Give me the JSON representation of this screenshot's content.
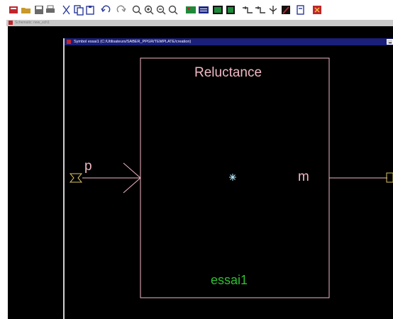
{
  "toolbar": {
    "buttons": [
      {
        "name": "new-schematic-icon",
        "color": "#c0262c"
      },
      {
        "name": "open-folder-icon",
        "color": "#c89a2a"
      },
      {
        "name": "save-icon",
        "color": "#6a6a6a"
      },
      {
        "name": "print-icon",
        "color": "#6a6a6a"
      },
      {
        "name": "cut-icon",
        "color": "#2a3a9a"
      },
      {
        "name": "copy-icon",
        "color": "#2a3a9a"
      },
      {
        "name": "paste-icon",
        "color": "#2a3a9a"
      },
      {
        "name": "undo-icon",
        "color": "#2a3a9a"
      },
      {
        "name": "redo-icon",
        "color": "#888888"
      },
      {
        "name": "zoom-fit-icon",
        "color": "#444444"
      },
      {
        "name": "zoom-in-icon",
        "color": "#444444"
      },
      {
        "name": "zoom-out-icon",
        "color": "#444444"
      },
      {
        "name": "zoom-area-icon",
        "color": "#444444"
      },
      {
        "name": "hierarchy-icon",
        "color": "#1f8a3a"
      },
      {
        "name": "net-list-icon",
        "color": "#1f2a8a"
      },
      {
        "name": "grid-icon",
        "color": "#1f8a3a"
      },
      {
        "name": "component-icon",
        "color": "#1f8a3a"
      },
      {
        "name": "wire-icon",
        "color": "#333333"
      },
      {
        "name": "bus-icon",
        "color": "#333333"
      },
      {
        "name": "pin-icon",
        "color": "#333333"
      },
      {
        "name": "probe-icon",
        "color": "#b0262c"
      },
      {
        "name": "simulate-icon",
        "color": "#2a3a9a"
      },
      {
        "name": "stop-icon",
        "color": "#c0262c"
      }
    ]
  },
  "outer_window": {
    "title": "Schematic: new_sch1",
    "icon_color": "#c0262c",
    "background": "#000000"
  },
  "inner_window": {
    "title": "Symbol essai1 (C:/Utilisateurs/SABER_PPGR/TEMPLATE/creation)",
    "icon_color": "#c0262c",
    "title_color": "#1a1f7a"
  },
  "symbol": {
    "title": "Reluctance",
    "instance_name": "essai1",
    "pin_left_label": "p",
    "pin_right_label": "m",
    "outline_color": "#f0b8c4",
    "name_color": "#2fbf2f",
    "pin_color": "#d8c468",
    "origin_color": "#b8ecff"
  }
}
